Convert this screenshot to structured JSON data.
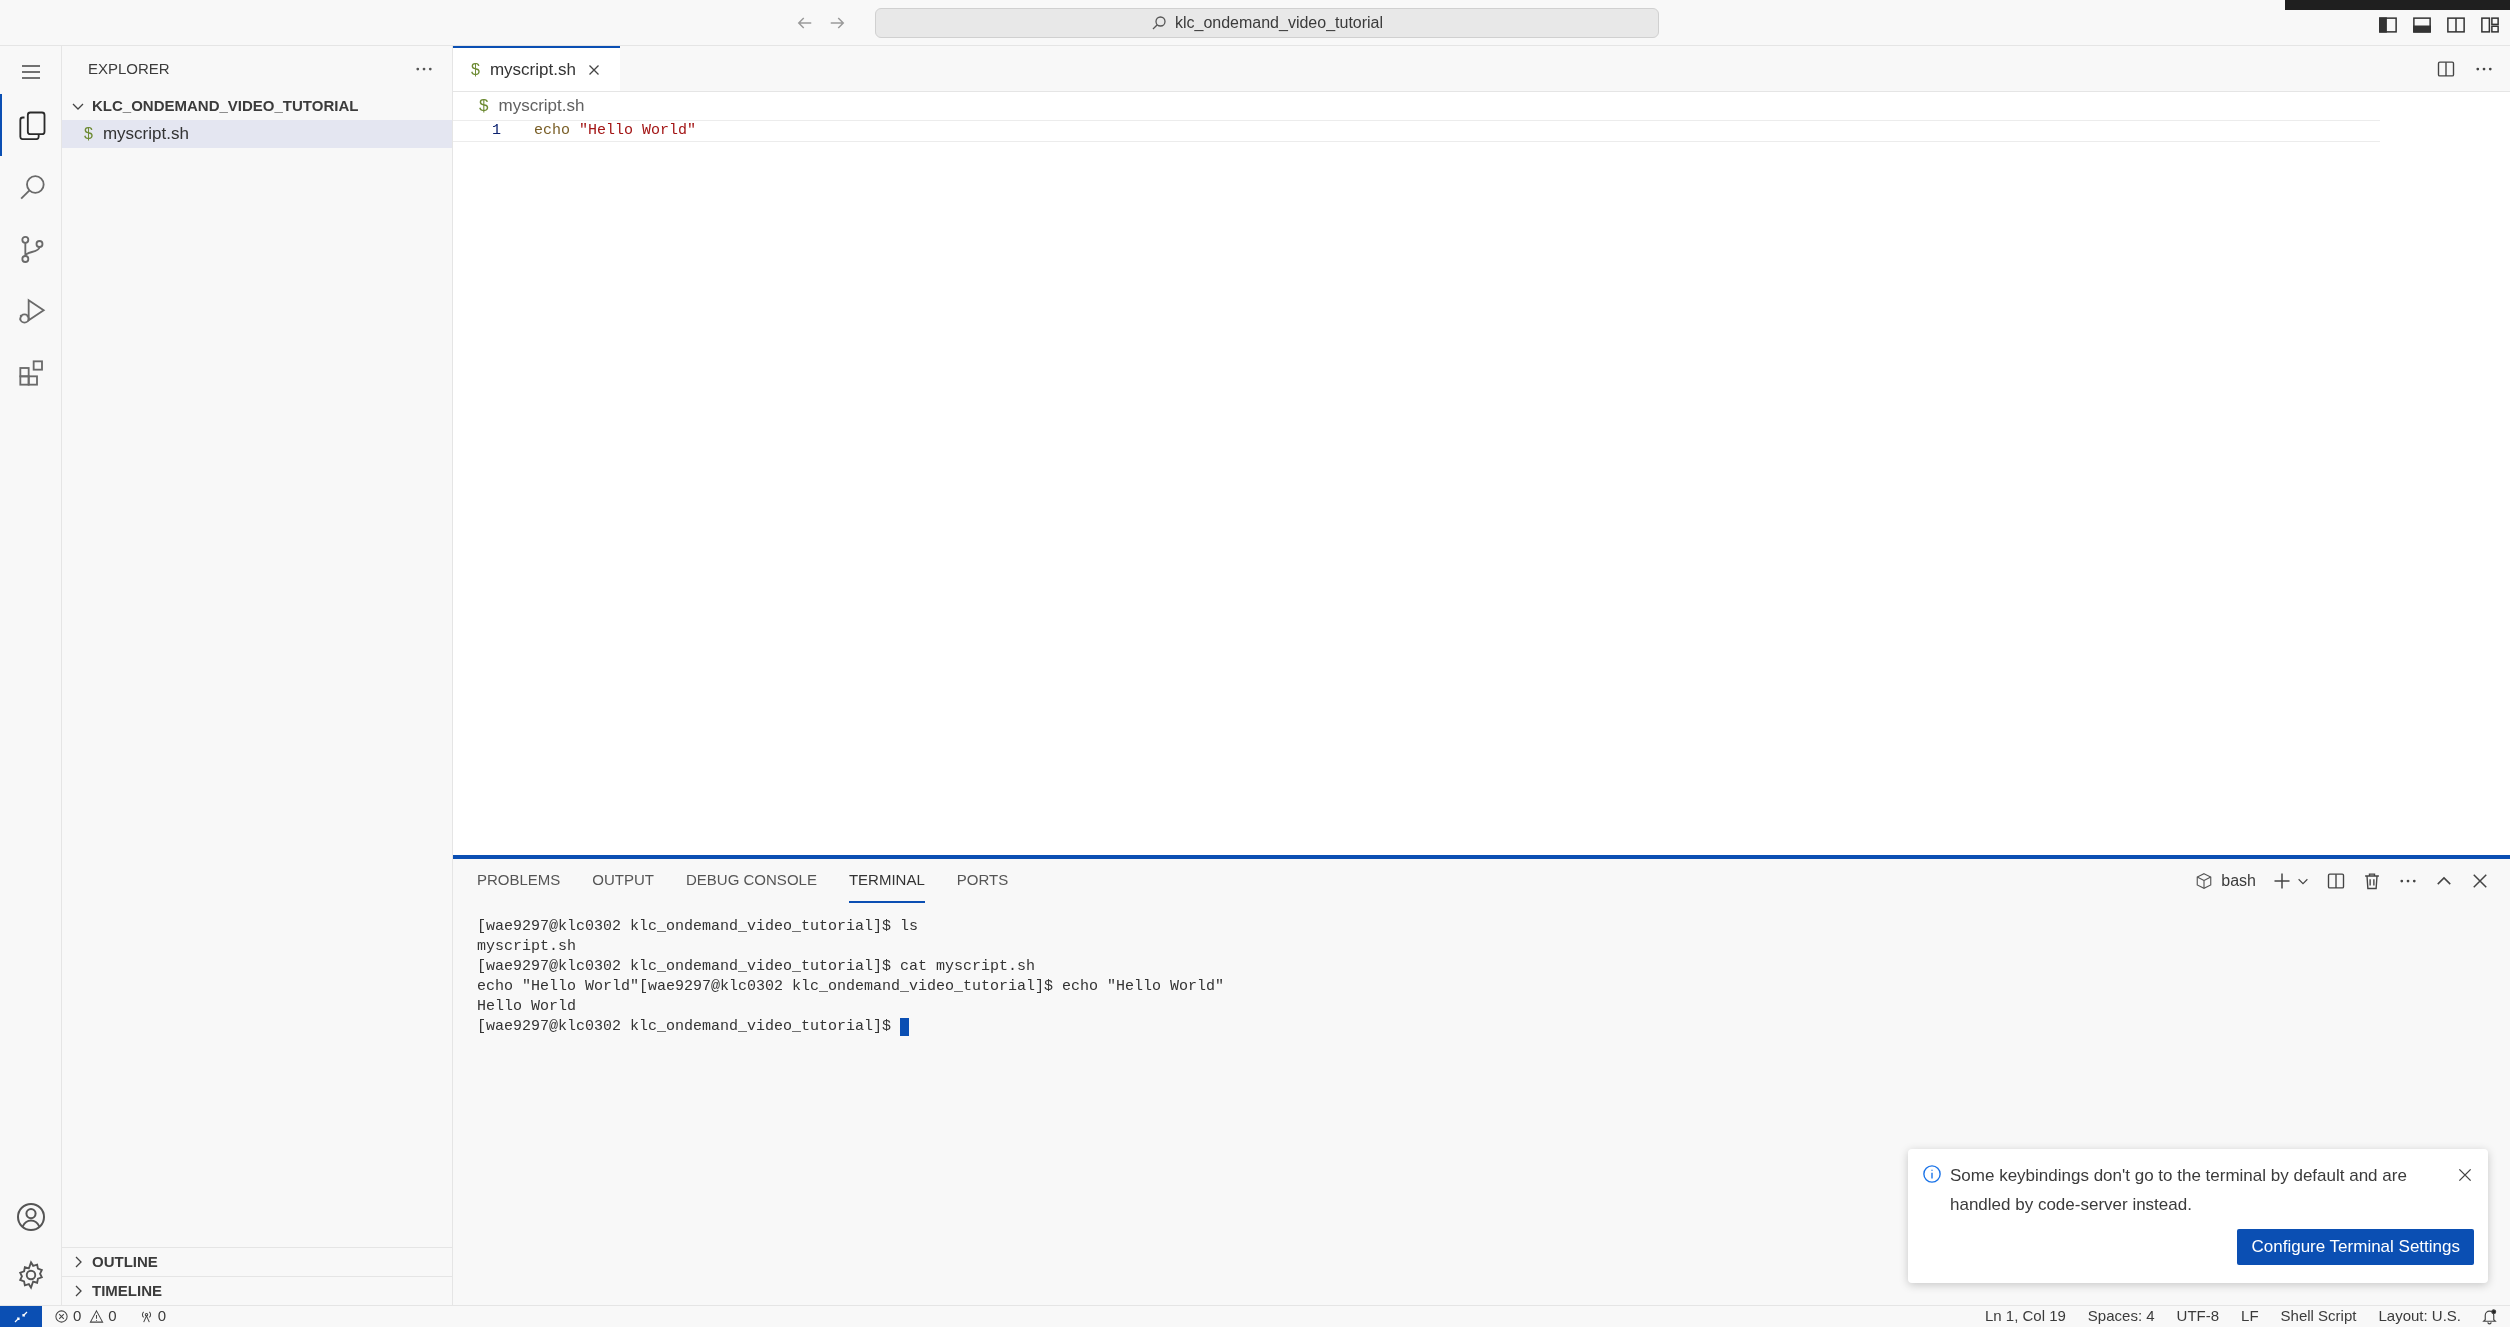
{
  "title_bar": {
    "search": "klc_ondemand_video_tutorial"
  },
  "activity_bar": [
    {
      "kind": "files",
      "selected": true
    },
    {
      "kind": "search",
      "selected": false
    },
    {
      "kind": "source-control",
      "selected": false
    },
    {
      "kind": "run",
      "selected": false
    },
    {
      "kind": "extensions",
      "selected": false
    }
  ],
  "sidebar": {
    "title": "EXPLORER",
    "folder": {
      "name": "KLC_ONDEMAND_VIDEO_TUTORIAL",
      "expanded": true,
      "children": [
        {
          "icon": "$",
          "name": "myscript.sh",
          "selected": true
        }
      ]
    },
    "sections": [
      {
        "label": "OUTLINE",
        "expanded": false
      },
      {
        "label": "TIMELINE",
        "expanded": false
      }
    ]
  },
  "editor": {
    "tabs": [
      {
        "icon": "$",
        "label": "myscript.sh",
        "selected": true
      }
    ],
    "breadcrumb": {
      "icon": "$",
      "label": "myscript.sh"
    },
    "lines": [
      {
        "number": "1",
        "tokens": [
          {
            "kind": "command",
            "text": "echo"
          },
          {
            "kind": "string",
            "text": "\"Hello World\""
          }
        ]
      }
    ]
  },
  "panel": {
    "tabs": [
      {
        "label": "PROBLEMS",
        "selected": false
      },
      {
        "label": "OUTPUT",
        "selected": false
      },
      {
        "label": "DEBUG CONSOLE",
        "selected": false
      },
      {
        "label": "TERMINAL",
        "selected": true
      },
      {
        "label": "PORTS",
        "selected": false
      }
    ],
    "terminal_profile": "bash",
    "terminal_lines": [
      "[wae9297@klc0302 klc_ondemand_video_tutorial]$ ls",
      "myscript.sh",
      "[wae9297@klc0302 klc_ondemand_video_tutorial]$ cat myscript.sh",
      "echo \"Hello World\"[wae9297@klc0302 klc_ondemand_video_tutorial]$ echo \"Hello World\"",
      "Hello World",
      "[wae9297@klc0302 klc_ondemand_video_tutorial]$"
    ]
  },
  "notification": {
    "message": "Some keybindings don't go to the terminal by default and are handled by code-server instead.",
    "button": "Configure Terminal Settings"
  },
  "status_bar": {
    "errors": "0",
    "warnings": "0",
    "ports": "0",
    "right": [
      "Ln 1, Col 19",
      "Spaces: 4",
      "UTF-8",
      "LF",
      "Shell Script",
      "Layout: U.S."
    ]
  }
}
